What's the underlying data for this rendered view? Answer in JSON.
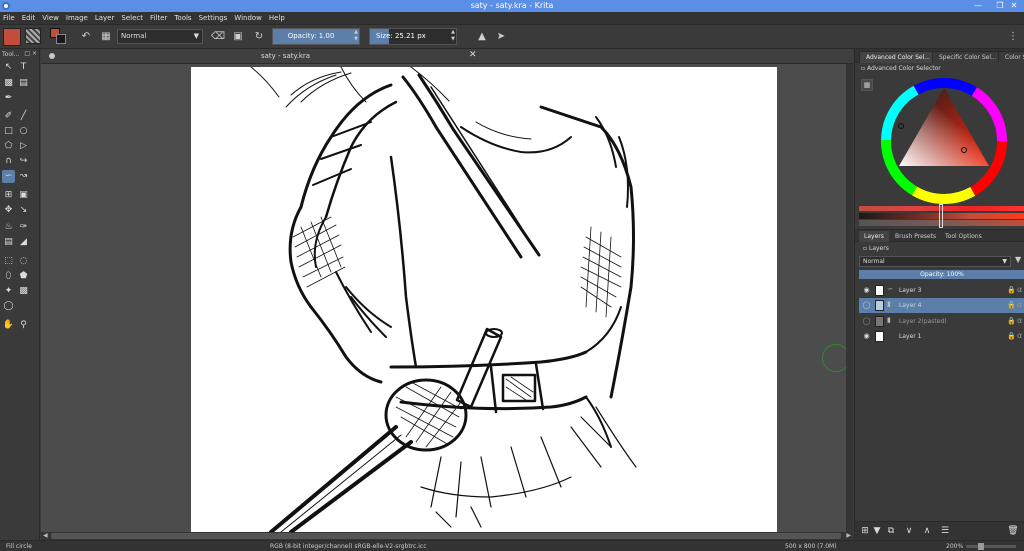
{
  "window": {
    "title": "saty - saty.kra  - Krita",
    "minimize": "—",
    "maximize": "❐",
    "close": "✕"
  },
  "menu": [
    "File",
    "Edit",
    "View",
    "Image",
    "Layer",
    "Select",
    "Filter",
    "Tools",
    "Settings",
    "Window",
    "Help"
  ],
  "toolbar": {
    "blend_mode": "Normal",
    "opacity_label": "Opacity:  1.00",
    "opacity_value": 1.0,
    "size_label": "Size:  25.21 px",
    "size_fraction": 0.22
  },
  "toolbox": {
    "header": "Tool...",
    "active_tool": "freehand-path-tool"
  },
  "document": {
    "tab_name": "saty - saty.kra",
    "close": "✕"
  },
  "dock": {
    "tabs": [
      "Advanced Color Sel...",
      "Specific Color Sel...",
      "Color S"
    ],
    "color_selector_title": "Advanced Color Selector",
    "current_color": "#c24d3a",
    "layer_tabs": [
      "Layers",
      "Brush Presets",
      "Tool Options"
    ],
    "layers_title": "Layers",
    "blend_mode": "Normal",
    "opacity_label": "Opacity:  100%",
    "layers": [
      {
        "name": "Layer 3",
        "visible": true,
        "selected": false
      },
      {
        "name": "Layer 4",
        "visible": false,
        "selected": true
      },
      {
        "name": "Layer 2(pasted)",
        "visible": false,
        "selected": false
      },
      {
        "name": "Layer 1",
        "visible": true,
        "selected": false
      }
    ]
  },
  "status": {
    "tool": "Fill circle",
    "color_info": "RGB (8-bit integer/channel)  sRGB-elle-V2-srgbtrc.icc",
    "image_size": "500 x 800 (7.0M)",
    "zoom": "200%"
  }
}
